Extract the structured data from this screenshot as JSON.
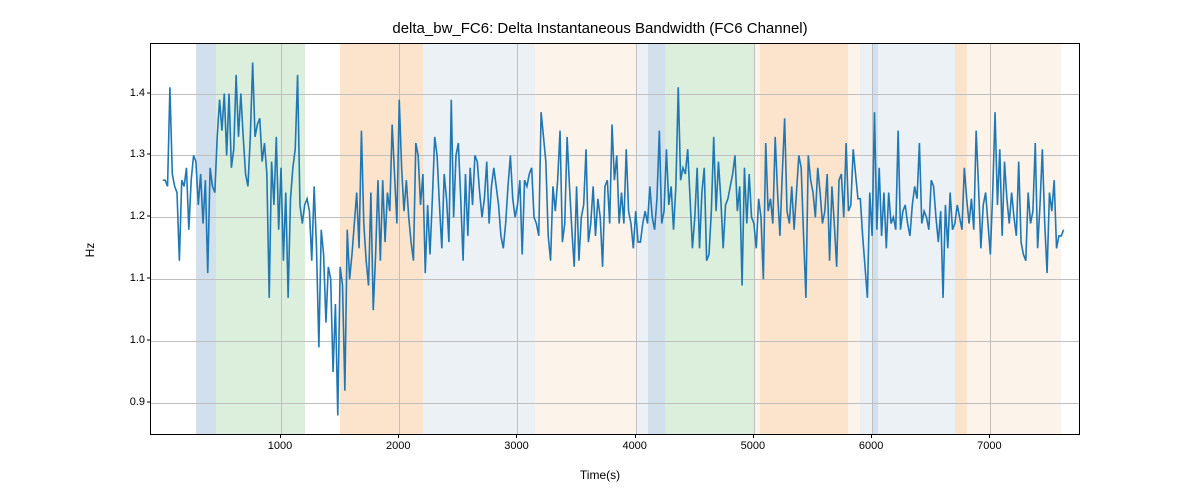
{
  "chart_data": {
    "type": "line",
    "title": "delta_bw_FC6: Delta Instantaneous Bandwidth (FC6 Channel)",
    "xlabel": "Time(s)",
    "ylabel": "Hz",
    "xlim": [
      -100,
      7750
    ],
    "ylim": [
      0.85,
      1.48
    ],
    "xticks": [
      1000,
      2000,
      3000,
      4000,
      5000,
      6000,
      7000
    ],
    "yticks": [
      0.9,
      1.0,
      1.1,
      1.2,
      1.3,
      1.4
    ],
    "bands": [
      {
        "x0": 280,
        "x1": 450,
        "color": "#7fa7cc"
      },
      {
        "x0": 450,
        "x1": 1200,
        "color": "#9bd19b"
      },
      {
        "x0": 1500,
        "x1": 2200,
        "color": "#f5b36e"
      },
      {
        "x0": 2200,
        "x1": 3150,
        "color": "#c9d6e6"
      },
      {
        "x0": 3150,
        "x1": 4000,
        "color": "#f7dfc2"
      },
      {
        "x0": 4000,
        "x1": 4100,
        "color": "#c9d6e6"
      },
      {
        "x0": 4100,
        "x1": 4250,
        "color": "#7fa7cc"
      },
      {
        "x0": 4250,
        "x1": 5000,
        "color": "#9bd19b"
      },
      {
        "x0": 5000,
        "x1": 5050,
        "color": "#f7dfc2"
      },
      {
        "x0": 5050,
        "x1": 5800,
        "color": "#f5b36e"
      },
      {
        "x0": 5800,
        "x1": 5900,
        "color": "#f7dfc2"
      },
      {
        "x0": 5900,
        "x1": 6000,
        "color": "#c9d6e6"
      },
      {
        "x0": 6000,
        "x1": 6050,
        "color": "#7fa7cc"
      },
      {
        "x0": 6050,
        "x1": 6700,
        "color": "#c9d6e6"
      },
      {
        "x0": 6700,
        "x1": 6800,
        "color": "#f5b36e"
      },
      {
        "x0": 6800,
        "x1": 7600,
        "color": "#f7dfc2"
      }
    ],
    "x": [
      0,
      20,
      40,
      60,
      80,
      100,
      120,
      140,
      160,
      180,
      200,
      220,
      240,
      260,
      280,
      300,
      320,
      340,
      360,
      380,
      400,
      420,
      440,
      460,
      480,
      500,
      520,
      540,
      560,
      580,
      600,
      620,
      640,
      660,
      680,
      700,
      720,
      740,
      760,
      780,
      800,
      820,
      840,
      860,
      880,
      900,
      920,
      940,
      960,
      980,
      1000,
      1020,
      1040,
      1060,
      1080,
      1100,
      1120,
      1140,
      1160,
      1180,
      1200,
      1220,
      1240,
      1260,
      1280,
      1300,
      1320,
      1340,
      1360,
      1380,
      1400,
      1420,
      1440,
      1460,
      1480,
      1500,
      1520,
      1540,
      1560,
      1580,
      1600,
      1620,
      1640,
      1660,
      1680,
      1700,
      1720,
      1740,
      1760,
      1780,
      1800,
      1820,
      1840,
      1860,
      1880,
      1900,
      1920,
      1940,
      1960,
      1980,
      2000,
      2020,
      2040,
      2060,
      2080,
      2100,
      2120,
      2140,
      2160,
      2180,
      2200,
      2220,
      2240,
      2260,
      2280,
      2300,
      2320,
      2340,
      2360,
      2380,
      2400,
      2420,
      2440,
      2460,
      2480,
      2500,
      2520,
      2540,
      2560,
      2580,
      2600,
      2620,
      2640,
      2660,
      2680,
      2700,
      2720,
      2740,
      2760,
      2780,
      2800,
      2820,
      2840,
      2860,
      2880,
      2900,
      2920,
      2940,
      2960,
      2980,
      3000,
      3020,
      3040,
      3060,
      3080,
      3100,
      3120,
      3140,
      3160,
      3180,
      3200,
      3220,
      3240,
      3260,
      3280,
      3300,
      3320,
      3340,
      3360,
      3380,
      3400,
      3420,
      3440,
      3460,
      3480,
      3500,
      3520,
      3540,
      3560,
      3580,
      3600,
      3620,
      3640,
      3660,
      3680,
      3700,
      3720,
      3740,
      3760,
      3780,
      3800,
      3820,
      3840,
      3860,
      3880,
      3900,
      3920,
      3940,
      3960,
      3980,
      4000,
      4020,
      4040,
      4060,
      4080,
      4100,
      4120,
      4140,
      4160,
      4180,
      4200,
      4220,
      4240,
      4260,
      4280,
      4300,
      4320,
      4340,
      4360,
      4380,
      4400,
      4420,
      4440,
      4460,
      4480,
      4500,
      4520,
      4540,
      4560,
      4580,
      4600,
      4620,
      4640,
      4660,
      4680,
      4700,
      4720,
      4740,
      4760,
      4780,
      4800,
      4820,
      4840,
      4860,
      4880,
      4900,
      4920,
      4940,
      4960,
      4980,
      5000,
      5020,
      5040,
      5060,
      5080,
      5100,
      5120,
      5140,
      5160,
      5180,
      5200,
      5220,
      5240,
      5260,
      5280,
      5300,
      5320,
      5340,
      5360,
      5380,
      5400,
      5420,
      5440,
      5460,
      5480,
      5500,
      5520,
      5540,
      5560,
      5580,
      5600,
      5620,
      5640,
      5660,
      5680,
      5700,
      5720,
      5740,
      5760,
      5780,
      5800,
      5820,
      5840,
      5860,
      5880,
      5900,
      5920,
      5940,
      5960,
      5980,
      6000,
      6020,
      6040,
      6060,
      6080,
      6100,
      6120,
      6140,
      6160,
      6180,
      6200,
      6220,
      6240,
      6260,
      6280,
      6300,
      6320,
      6340,
      6360,
      6380,
      6400,
      6420,
      6440,
      6460,
      6480,
      6500,
      6520,
      6540,
      6560,
      6580,
      6600,
      6620,
      6640,
      6660,
      6680,
      6700,
      6720,
      6740,
      6760,
      6780,
      6800,
      6820,
      6840,
      6860,
      6880,
      6900,
      6920,
      6940,
      6960,
      6980,
      7000,
      7020,
      7040,
      7060,
      7080,
      7100,
      7120,
      7140,
      7160,
      7180,
      7200,
      7220,
      7240,
      7260,
      7280,
      7300,
      7320,
      7340,
      7360,
      7380,
      7400,
      7420,
      7440,
      7460,
      7480,
      7500,
      7520,
      7540,
      7560,
      7580,
      7600,
      7620
    ],
    "values": [
      1.26,
      1.26,
      1.25,
      1.41,
      1.27,
      1.25,
      1.24,
      1.13,
      1.26,
      1.25,
      1.28,
      1.18,
      1.26,
      1.3,
      1.29,
      1.22,
      1.27,
      1.19,
      1.26,
      1.11,
      1.28,
      1.25,
      1.24,
      1.33,
      1.39,
      1.34,
      1.4,
      1.3,
      1.4,
      1.28,
      1.31,
      1.43,
      1.33,
      1.4,
      1.33,
      1.27,
      1.25,
      1.33,
      1.45,
      1.33,
      1.35,
      1.36,
      1.29,
      1.32,
      1.27,
      1.07,
      1.29,
      1.22,
      1.33,
      1.18,
      1.28,
      1.13,
      1.24,
      1.07,
      1.23,
      1.28,
      1.31,
      1.43,
      1.22,
      1.19,
      1.22,
      1.23,
      1.21,
      1.13,
      1.25,
      1.15,
      0.99,
      1.18,
      1.14,
      1.03,
      1.12,
      1.1,
      0.95,
      1.06,
      0.88,
      1.12,
      1.09,
      0.92,
      1.18,
      1.1,
      1.14,
      1.19,
      1.24,
      1.15,
      1.34,
      1.19,
      1.13,
      1.09,
      1.24,
      1.05,
      1.14,
      1.26,
      1.13,
      1.26,
      1.16,
      1.24,
      1.21,
      1.35,
      1.27,
      1.19,
      1.39,
      1.28,
      1.21,
      1.26,
      1.2,
      1.16,
      1.13,
      1.32,
      1.3,
      1.22,
      1.27,
      1.11,
      1.22,
      1.14,
      1.23,
      1.33,
      1.3,
      1.22,
      1.15,
      1.27,
      1.23,
      1.16,
      1.39,
      1.2,
      1.3,
      1.32,
      1.23,
      1.13,
      1.27,
      1.17,
      1.28,
      1.22,
      1.3,
      1.29,
      1.24,
      1.2,
      1.23,
      1.29,
      1.19,
      1.25,
      1.28,
      1.25,
      1.22,
      1.17,
      1.15,
      1.19,
      1.25,
      1.3,
      1.23,
      1.2,
      1.22,
      1.26,
      1.14,
      1.26,
      1.25,
      1.27,
      1.28,
      1.2,
      1.19,
      1.17,
      1.37,
      1.33,
      1.29,
      1.17,
      1.13,
      1.25,
      1.21,
      1.26,
      1.34,
      1.16,
      1.19,
      1.33,
      1.25,
      1.18,
      1.12,
      1.25,
      1.13,
      1.2,
      1.22,
      1.31,
      1.16,
      1.19,
      1.25,
      1.17,
      1.23,
      1.2,
      1.12,
      1.25,
      1.26,
      1.19,
      1.35,
      1.26,
      1.3,
      1.19,
      1.24,
      1.19,
      1.31,
      1.21,
      1.19,
      1.15,
      1.21,
      1.16,
      1.16,
      1.19,
      1.21,
      1.19,
      1.25,
      1.2,
      1.18,
      1.23,
      1.34,
      1.19,
      1.21,
      1.31,
      1.22,
      1.25,
      1.18,
      1.25,
      1.41,
      1.26,
      1.28,
      1.27,
      1.31,
      1.23,
      1.15,
      1.2,
      1.28,
      1.15,
      1.24,
      1.28,
      1.13,
      1.14,
      1.21,
      1.33,
      1.21,
      1.29,
      1.23,
      1.15,
      1.22,
      1.23,
      1.25,
      1.27,
      1.3,
      1.21,
      1.25,
      1.09,
      1.28,
      1.19,
      1.27,
      1.2,
      1.19,
      1.15,
      1.23,
      1.2,
      1.1,
      1.32,
      1.21,
      1.23,
      1.19,
      1.33,
      1.24,
      1.17,
      1.27,
      1.36,
      1.21,
      1.19,
      1.25,
      1.18,
      1.24,
      1.3,
      1.28,
      1.17,
      1.07,
      1.3,
      1.26,
      1.24,
      1.2,
      1.28,
      1.24,
      1.19,
      1.21,
      1.27,
      1.13,
      1.25,
      1.19,
      1.12,
      1.26,
      1.27,
      1.2,
      1.32,
      1.21,
      1.22,
      1.31,
      1.27,
      1.23,
      1.23,
      1.17,
      1.12,
      1.07,
      1.24,
      1.17,
      1.37,
      1.18,
      1.28,
      1.17,
      1.24,
      1.15,
      1.24,
      1.19,
      1.2,
      1.18,
      1.34,
      1.18,
      1.21,
      1.22,
      1.19,
      1.17,
      1.22,
      1.25,
      1.23,
      1.32,
      1.19,
      1.21,
      1.2,
      1.18,
      1.26,
      1.25,
      1.2,
      1.16,
      1.21,
      1.07,
      1.22,
      1.15,
      1.24,
      1.18,
      1.19,
      1.22,
      1.2,
      1.18,
      1.28,
      1.23,
      1.19,
      1.23,
      1.18,
      1.34,
      1.25,
      1.15,
      1.22,
      1.24,
      1.19,
      1.14,
      1.24,
      1.37,
      1.22,
      1.31,
      1.17,
      1.29,
      1.23,
      1.19,
      1.24,
      1.2,
      1.17,
      1.29,
      1.16,
      1.14,
      1.13,
      1.24,
      1.19,
      1.21,
      1.32,
      1.15,
      1.22,
      1.31,
      1.19,
      1.11,
      1.24,
      1.21,
      1.26,
      1.15,
      1.17,
      1.17,
      1.18
    ]
  }
}
